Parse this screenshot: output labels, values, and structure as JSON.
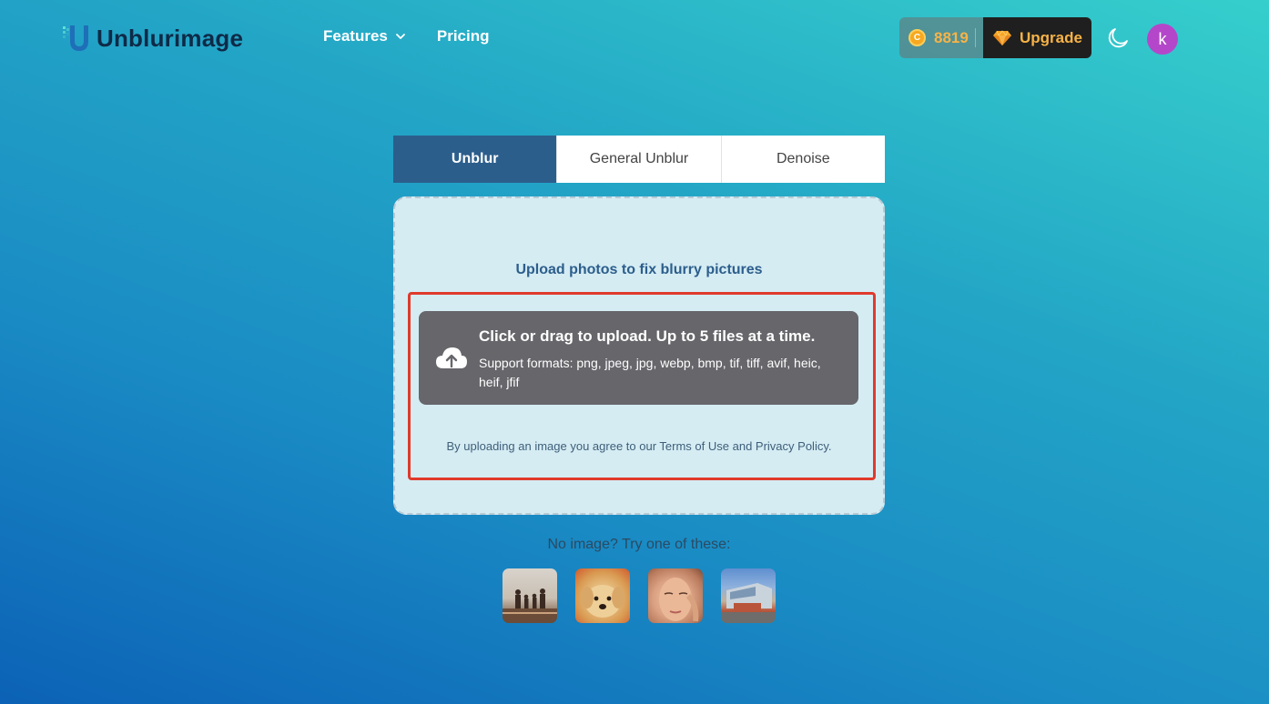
{
  "header": {
    "logo_text": "Unblurimage",
    "nav": [
      {
        "label": "Features",
        "has_dropdown": true
      },
      {
        "label": "Pricing",
        "has_dropdown": false
      }
    ],
    "credits": "8819",
    "upgrade_label": "Upgrade",
    "avatar_initial": "k"
  },
  "tabs": [
    {
      "label": "Unblur",
      "active": true
    },
    {
      "label": "General Unblur",
      "active": false
    },
    {
      "label": "Denoise",
      "active": false
    }
  ],
  "upload": {
    "title": "Upload photos to fix blurry pictures",
    "dropzone_title": "Click or drag to upload. Up to 5 files at a time.",
    "formats": "Support formats: png, jpeg, jpg, webp, bmp, tif, tiff, avif, heic, heif, jfif",
    "terms_prefix": "By uploading an image you agree to our ",
    "terms_link": "Terms of Use",
    "terms_and": " and ",
    "privacy_link": "Privacy Policy",
    "terms_suffix": "."
  },
  "samples": {
    "label": "No image? Try one of these:",
    "items": [
      "family-beach-photo",
      "puppy-photo",
      "woman-face-photo",
      "building-photo"
    ]
  },
  "colors": {
    "active_tab": "#2c5e8c",
    "accent_gold": "#f7b347",
    "highlight_red": "#e03a2c",
    "avatar": "#b447c9"
  }
}
